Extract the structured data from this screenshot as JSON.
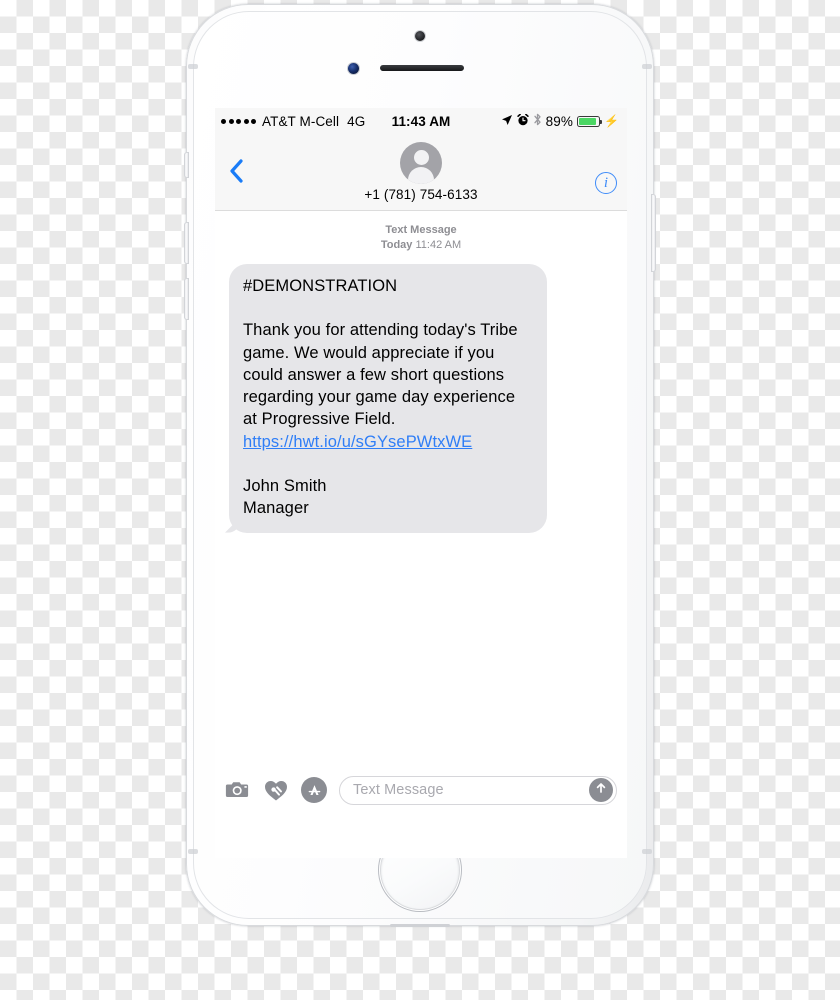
{
  "device": {
    "name": "iPhone 6 silver",
    "frame_color": "#f6f7f8"
  },
  "status_bar": {
    "signal_dots": 5,
    "carrier": "AT&T M-Cell",
    "network": "4G",
    "time": "11:43 AM",
    "battery_percent": "89%",
    "battery_level": 89,
    "battery_color": "#4cd764",
    "icons": [
      "location-arrow-icon",
      "alarm-clock-icon",
      "bluetooth-icon",
      "battery-icon",
      "charging-bolt-icon"
    ]
  },
  "nav_bar": {
    "back_label": "back-chevron",
    "contact_number": "+1 (781) 754-6133",
    "info_label": "i",
    "accent_color": "#3f8cf9"
  },
  "conversation": {
    "meta_type": "Text Message",
    "meta_day": "Today",
    "meta_time": "11:42 AM",
    "bubble_color": "#e6e6e9",
    "link_color": "#2f7ef7",
    "message": {
      "heading": "#DEMONSTRATION",
      "body": "Thank you for attending today's Tribe game. We would appreciate if you could answer a few short questions regarding your game day experience at Progressive Field.",
      "link": "https://hwt.io/u/sGYsePWtxWE",
      "signature_name": "John Smith",
      "signature_title": "Manager"
    }
  },
  "input_bar": {
    "camera_icon": "camera-icon",
    "digital_touch_icon": "digital-touch-heart-icon",
    "app_store_icon": "app-store-icon",
    "placeholder": "Text Message",
    "send_icon": "send-arrow-up-icon"
  }
}
